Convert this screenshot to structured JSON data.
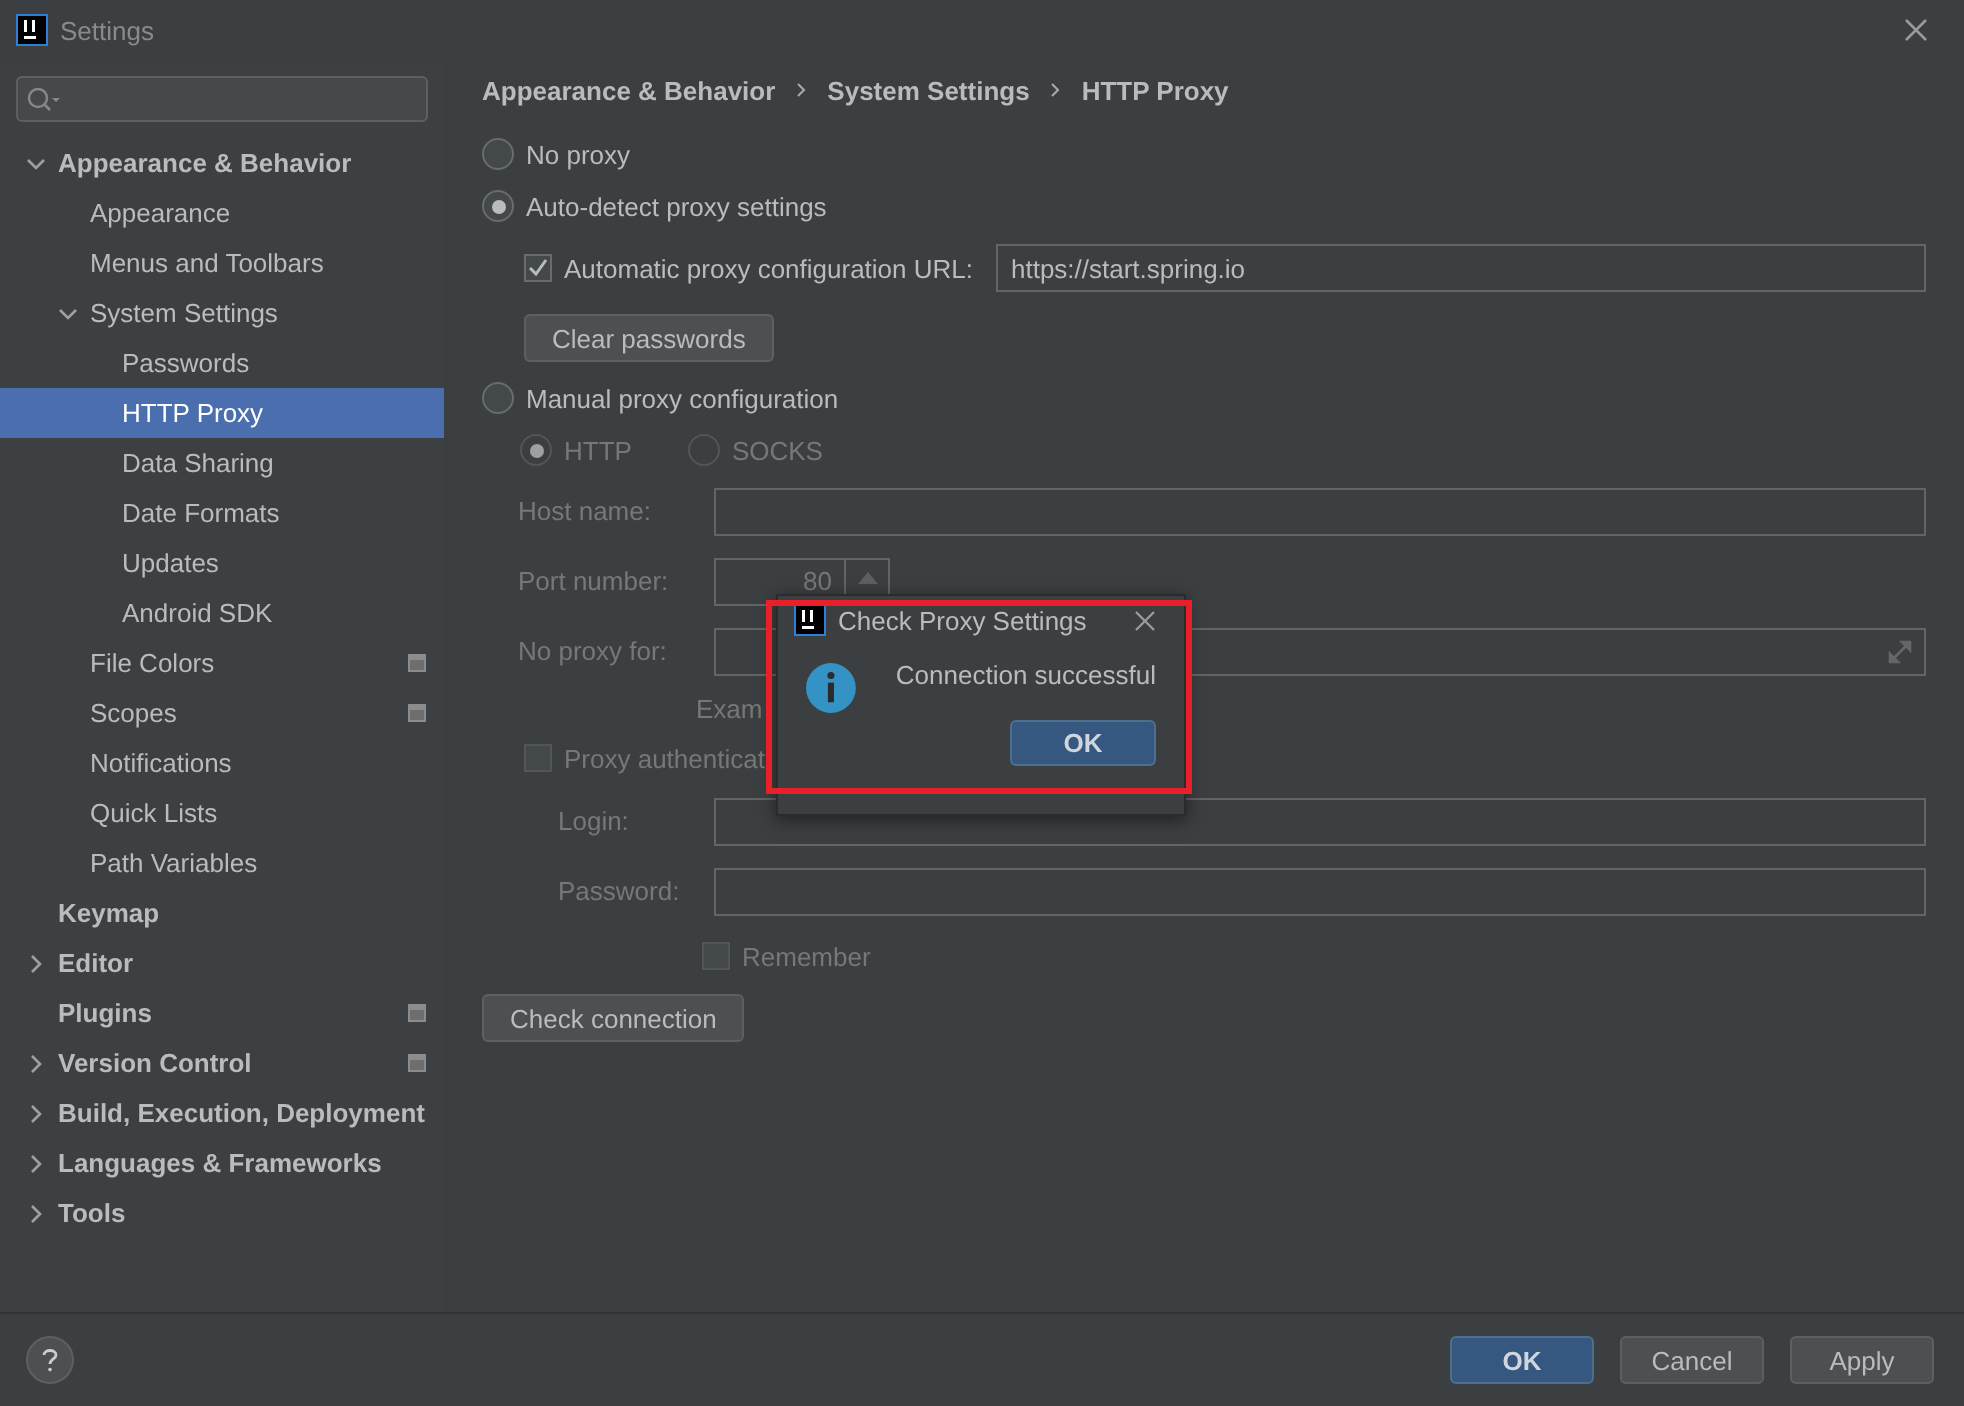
{
  "window": {
    "title": "Settings"
  },
  "sidebar": {
    "items": [
      {
        "label": "Appearance & Behavior",
        "expanded": true,
        "selected": false,
        "children": [
          {
            "label": "Appearance",
            "selected": false
          },
          {
            "label": "Menus and Toolbars",
            "selected": false
          },
          {
            "label": "System Settings",
            "expanded": true,
            "selected": false,
            "children": [
              {
                "label": "Passwords",
                "selected": false
              },
              {
                "label": "HTTP Proxy",
                "selected": true
              },
              {
                "label": "Data Sharing",
                "selected": false
              },
              {
                "label": "Date Formats",
                "selected": false
              },
              {
                "label": "Updates",
                "selected": false
              },
              {
                "label": "Android SDK",
                "selected": false
              }
            ]
          },
          {
            "label": "File Colors",
            "selected": false,
            "badge": true
          },
          {
            "label": "Scopes",
            "selected": false,
            "badge": true
          },
          {
            "label": "Notifications",
            "selected": false
          },
          {
            "label": "Quick Lists",
            "selected": false
          },
          {
            "label": "Path Variables",
            "selected": false
          }
        ]
      },
      {
        "label": "Keymap",
        "selected": false
      },
      {
        "label": "Editor",
        "expanded": false,
        "selected": false
      },
      {
        "label": "Plugins",
        "selected": false,
        "badge": true
      },
      {
        "label": "Version Control",
        "expanded": false,
        "selected": false,
        "badge": true
      },
      {
        "label": "Build, Execution, Deployment",
        "expanded": false,
        "selected": false
      },
      {
        "label": "Languages & Frameworks",
        "expanded": false,
        "selected": false
      },
      {
        "label": "Tools",
        "expanded": false,
        "selected": false
      }
    ]
  },
  "breadcrumb": [
    "Appearance & Behavior",
    "System Settings",
    "HTTP Proxy"
  ],
  "proxy_modes": [
    {
      "label": "No proxy",
      "selected": false
    },
    {
      "label": "Auto-detect proxy settings",
      "selected": true
    },
    {
      "label": "Manual proxy configuration",
      "selected": false
    }
  ],
  "auto": {
    "url_checkbox": {
      "label": "Automatic proxy configuration URL:",
      "checked": true
    },
    "url": "https://start.spring.io",
    "clear_button": "Clear passwords"
  },
  "manual": {
    "disabled": true,
    "protocols": [
      {
        "label": "HTTP",
        "selected": true
      },
      {
        "label": "SOCKS",
        "selected": false
      }
    ],
    "host_label": "Host name:",
    "port_label": "Port number:",
    "port": "80",
    "no_proxy_label": "No proxy for:",
    "example": "Exam",
    "auth": {
      "label": "Proxy authenticat",
      "checked": false
    },
    "login_label": "Login:",
    "password_label": "Password:",
    "remember": {
      "label": "Remember",
      "checked": false
    }
  },
  "check_button": "Check connection",
  "dialog": {
    "title": "Check Proxy Settings",
    "message": "Connection successful",
    "button": "OK"
  },
  "footer": {
    "buttons": [
      {
        "label": "OK",
        "primary": true
      },
      {
        "label": "Cancel",
        "primary": false
      },
      {
        "label": "Apply",
        "primary": false
      }
    ]
  }
}
